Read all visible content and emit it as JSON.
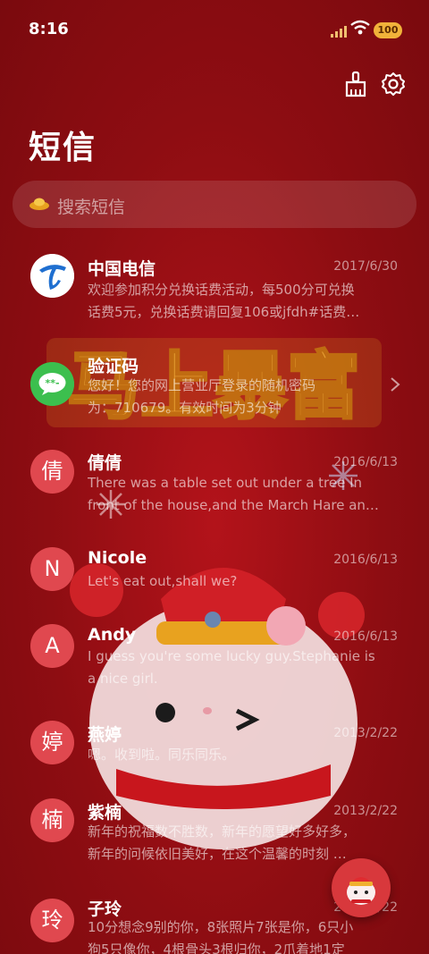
{
  "status_bar": {
    "time": "8:16",
    "battery": "100",
    "icons": [
      "signal-icon",
      "wifi-icon",
      "battery-icon"
    ]
  },
  "toolbar": {
    "icons": [
      "clean-brush-icon",
      "settings-gear-icon"
    ]
  },
  "page_title": "短信",
  "search": {
    "placeholder": "搜索短信",
    "icon": "gold-ingot-icon"
  },
  "background": {
    "banner_text": "马上暴富"
  },
  "threads": [
    {
      "avatar_text": "",
      "avatar_icon": "china-telecom-logo",
      "sender": "中国电信",
      "date": "2017/6/30",
      "preview_line1": "欢迎参加积分兑换话费活动，每500分可兑换",
      "preview_line2": "话费5元，兑换话费请回复106或jfdh#话费…"
    },
    {
      "avatar_text": "",
      "avatar_icon": "message-bubble-icon",
      "sender": "验证码",
      "date": "",
      "preview_line1": "您好！您的网上营业厅登录的随机密码",
      "preview_line2": "为：710679。有效时间为3分钟"
    },
    {
      "avatar_text": "倩",
      "sender": "倩倩",
      "date": "2016/6/13",
      "preview_line1": "There was a table set out under a tree In",
      "preview_line2": "front of the house,and the March Hare an…"
    },
    {
      "avatar_text": "N",
      "sender": "Nicole",
      "date": "2016/6/13",
      "preview_line1": "Let's eat out,shall we?",
      "preview_line2": ""
    },
    {
      "avatar_text": "A",
      "sender": "Andy",
      "date": "2016/6/13",
      "preview_line1": "I guess you're some lucky guy.Stephanie is",
      "preview_line2": "a nice girl."
    },
    {
      "avatar_text": "婷",
      "sender": "燕婷",
      "date": "2013/2/22",
      "preview_line1": "嗯。收到啦。同乐同乐。",
      "preview_line2": ""
    },
    {
      "avatar_text": "楠",
      "sender": "紫楠",
      "date": "2013/2/22",
      "preview_line1": "新年的祝福数不胜数，新年的愿望好多好多，",
      "preview_line2": "新年的问候依旧美好，在这个温馨的时刻 …"
    },
    {
      "avatar_text": "玲",
      "sender": "子玲",
      "date": "2013/2/22",
      "preview_line1": "10分想念9别的你，8张照片7张是你，6只小",
      "preview_line2": "狗5只像你，4根骨头3根归你，2爪着地1定"
    }
  ],
  "colors": {
    "background": "#8e0d12",
    "avatar": "#e0484f",
    "fab": "#d8383c"
  }
}
